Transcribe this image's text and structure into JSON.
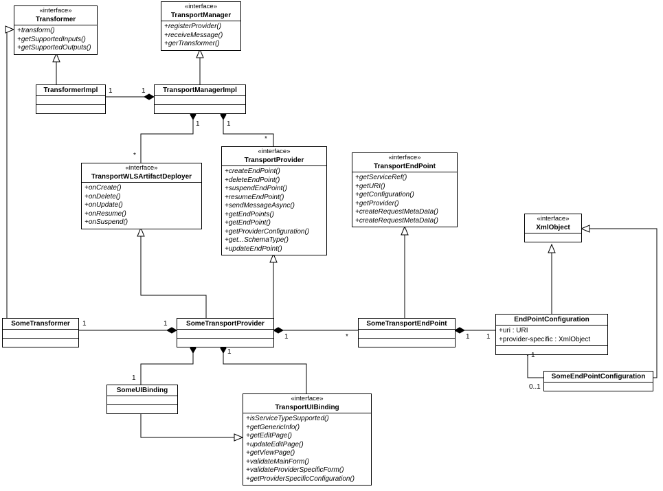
{
  "chart_data": {
    "type": "uml_class_diagram",
    "classes": [
      {
        "id": "Transformer",
        "stereotype": "«interface»",
        "name": "Transformer",
        "ops": [
          "+transform()",
          "+getSupportedInputs()",
          "+getSupportedOutputs()"
        ]
      },
      {
        "id": "TransportManager",
        "stereotype": "«interface»",
        "name": "TransportManager",
        "ops": [
          "+registerProvider()",
          "+receiveMessage()",
          "+gerTransformer()"
        ]
      },
      {
        "id": "TransformerImpl",
        "name": "TransformerImpl"
      },
      {
        "id": "TransportManagerImpl",
        "name": "TransportManagerImpl"
      },
      {
        "id": "TransportWLSArtifactDeployer",
        "stereotype": "«interface»",
        "name": "TransportWLSArtifactDeployer",
        "ops": [
          "+onCreate()",
          "+onDelete()",
          "+onUpdate()",
          "+onResume()",
          "+onSuspend()"
        ]
      },
      {
        "id": "TransportProvider",
        "stereotype": "«interface»",
        "name": "TransportProvider",
        "ops": [
          "+createEndPoint()",
          "+deleteEndPoint()",
          "+suspendEndPoint()",
          "+resumeEndPoint()",
          "+sendMessageAsync()",
          "+getEndPoints()",
          "+getEndPoint()",
          "+getProviderConfiguration()",
          "+get...SchemaType()",
          "+updateEndPoint()"
        ]
      },
      {
        "id": "TransportEndPoint",
        "stereotype": "«interface»",
        "name": "TransportEndPoint",
        "ops": [
          "+getServiceRef()",
          "+getURI()",
          "+getConfiguration()",
          "+getProvider()",
          "+createRequestMetaData()",
          "+createRequestMetaData()"
        ]
      },
      {
        "id": "XmlObject",
        "stereotype": "«interface»",
        "name": "XmlObject"
      },
      {
        "id": "SomeTransformer",
        "name": "SomeTransformer"
      },
      {
        "id": "SomeTransportProvider",
        "name": "SomeTransportProvider"
      },
      {
        "id": "SomeTransportEndPoint",
        "name": "SomeTransportEndPoint"
      },
      {
        "id": "EndPointConfiguration",
        "name": "EndPointConfiguration",
        "attrs": [
          "+uri : URI",
          "+provider-specific : XmlObject"
        ]
      },
      {
        "id": "SomeUIBinding",
        "name": "SomeUIBinding"
      },
      {
        "id": "TransportUIBinding",
        "stereotype": "«interface»",
        "name": "TransportUIBinding",
        "ops": [
          "+isServiceTypeSupported()",
          "+getGenericInfo()",
          "+getEditPage()",
          "+updateEditPage()",
          "+getViewPage()",
          "+validateMainForm()",
          "+validateProviderSpecificForm()",
          "+getProviderSpecificConfiguration()"
        ]
      },
      {
        "id": "SomeEndPointConfiguration",
        "name": "SomeEndPointConfiguration"
      }
    ],
    "relations": [
      {
        "from": "TransformerImpl",
        "to": "Transformer",
        "type": "realization"
      },
      {
        "from": "TransportManagerImpl",
        "to": "TransportManager",
        "type": "realization"
      },
      {
        "from": "TransportManagerImpl",
        "to": "TransformerImpl",
        "type": "composition",
        "m1": "1",
        "m2": "1"
      },
      {
        "from": "TransportManagerImpl",
        "to": "TransportWLSArtifactDeployer",
        "type": "composition",
        "m1": "1",
        "m2": "*"
      },
      {
        "from": "TransportManagerImpl",
        "to": "TransportProvider",
        "type": "composition",
        "m1": "1",
        "m2": "*"
      },
      {
        "from": "SomeTransportProvider",
        "to": "TransportWLSArtifactDeployer",
        "type": "realization"
      },
      {
        "from": "SomeTransportProvider",
        "to": "TransportProvider",
        "type": "realization"
      },
      {
        "from": "SomeTransportEndPoint",
        "to": "TransportEndPoint",
        "type": "realization"
      },
      {
        "from": "SomeTransportProvider",
        "to": "SomeTransformer",
        "type": "composition",
        "m1": "1",
        "m2": "1"
      },
      {
        "from": "SomeTransformer",
        "to": "Transformer",
        "type": "realization"
      },
      {
        "from": "SomeTransportProvider",
        "to": "SomeUIBinding",
        "type": "composition",
        "m1": "1",
        "m2": "1"
      },
      {
        "from": "SomeTransportProvider",
        "to": "SomeTransportEndPoint",
        "type": "composition",
        "m1": "1",
        "m2": "*"
      },
      {
        "from": "SomeUIBinding",
        "to": "TransportUIBinding",
        "type": "realization"
      },
      {
        "from": "SomeTransportEndPoint",
        "to": "EndPointConfiguration",
        "type": "composition",
        "m1": "1",
        "m2": "1"
      },
      {
        "from": "EndPointConfiguration",
        "to": "XmlObject",
        "type": "realization"
      },
      {
        "from": "EndPointConfiguration",
        "to": "SomeEndPointConfiguration",
        "type": "composition",
        "m1": "1",
        "m2": "0..1"
      },
      {
        "from": "SomeEndPointConfiguration",
        "to": "XmlObject",
        "type": "realization"
      }
    ]
  },
  "t": {
    "Transformer_s": "«interface»",
    "Transformer_n": "Transformer",
    "Transformer_o0": "+transform()",
    "Transformer_o1": "+getSupportedInputs()",
    "Transformer_o2": "+getSupportedOutputs()",
    "TransportManager_s": "«interface»",
    "TransportManager_n": "TransportManager",
    "TransportManager_o0": "+registerProvider()",
    "TransportManager_o1": "+receiveMessage()",
    "TransportManager_o2": "+gerTransformer()",
    "TransformerImpl_n": "TransformerImpl",
    "TransportManagerImpl_n": "TransportManagerImpl",
    "TWAD_s": "«interface»",
    "TWAD_n": "TransportWLSArtifactDeployer",
    "TWAD_o0": "+onCreate()",
    "TWAD_o1": "+onDelete()",
    "TWAD_o2": "+onUpdate()",
    "TWAD_o3": "+onResume()",
    "TWAD_o4": "+onSuspend()",
    "TP_s": "«interface»",
    "TP_n": "TransportProvider",
    "TP_o0": "+createEndPoint()",
    "TP_o1": "+deleteEndPoint()",
    "TP_o2": "+suspendEndPoint()",
    "TP_o3": "+resumeEndPoint()",
    "TP_o4": "+sendMessageAsync()",
    "TP_o5": "+getEndPoints()",
    "TP_o6": "+getEndPoint()",
    "TP_o7": "+getProviderConfiguration()",
    "TP_o8": "+get...SchemaType()",
    "TP_o9": "+updateEndPoint()",
    "TEP_s": "«interface»",
    "TEP_n": "TransportEndPoint",
    "TEP_o0": "+getServiceRef()",
    "TEP_o1": "+getURI()",
    "TEP_o2": "+getConfiguration()",
    "TEP_o3": "+getProvider()",
    "TEP_o4": "+createRequestMetaData()",
    "TEP_o5": "+createRequestMetaData()",
    "XO_s": "«interface»",
    "XO_n": "XmlObject",
    "ST_n": "SomeTransformer",
    "STP_n": "SomeTransportProvider",
    "STEP_n": "SomeTransportEndPoint",
    "EPC_n": "EndPointConfiguration",
    "EPC_a0": "+uri : URI",
    "EPC_a1": "+provider-specific : XmlObject",
    "SUB_n": "SomeUIBinding",
    "TUB_s": "«interface»",
    "TUB_n": "TransportUIBinding",
    "TUB_o0": "+isServiceTypeSupported()",
    "TUB_o1": "+getGenericInfo()",
    "TUB_o2": "+getEditPage()",
    "TUB_o3": "+updateEditPage()",
    "TUB_o4": "+getViewPage()",
    "TUB_o5": "+validateMainForm()",
    "TUB_o6": "+validateProviderSpecificForm()",
    "TUB_o7": "+getProviderSpecificConfiguration()",
    "SEPC_n": "SomeEndPointConfiguration",
    "m1": "1",
    "mstar": "*",
    "m01": "0..1"
  }
}
